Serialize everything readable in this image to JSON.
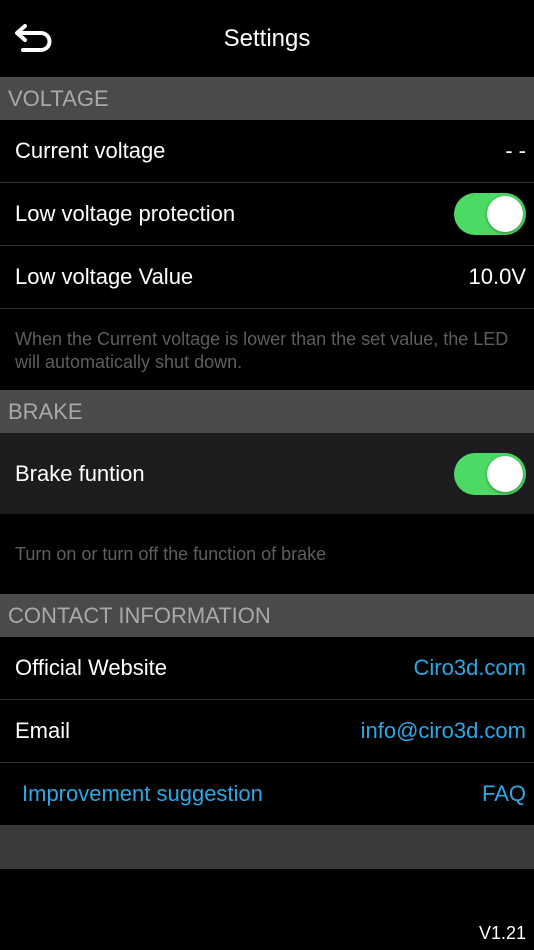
{
  "nav": {
    "title": "Settings",
    "back_icon": "back-arrow-icon"
  },
  "voltage": {
    "header": "VOLTAGE",
    "current_label": "Current voltage",
    "current_value": "- -",
    "protection_label": "Low voltage protection",
    "protection_on": true,
    "low_value_label": "Low voltage Value",
    "low_value": "10.0V",
    "note": "When the Current voltage is lower than the set value, the LED will automatically shut down."
  },
  "brake": {
    "header": "BRAKE",
    "function_label": "Brake funtion",
    "function_on": true,
    "note": "Turn on or turn off the function of brake"
  },
  "contact": {
    "header": "CONTACT INFORMATION",
    "website_label": "Official Website",
    "website_value": "Ciro3d.com",
    "email_label": "Email",
    "email_value": "info@ciro3d.com",
    "suggestion_link": "Improvement suggestion",
    "faq_link": "FAQ"
  },
  "footer": {
    "version": "V1.21"
  },
  "colors": {
    "toggle_on": "#4cd964",
    "link": "#2aa8e8",
    "section_header_bg": "#4a4a4a"
  }
}
